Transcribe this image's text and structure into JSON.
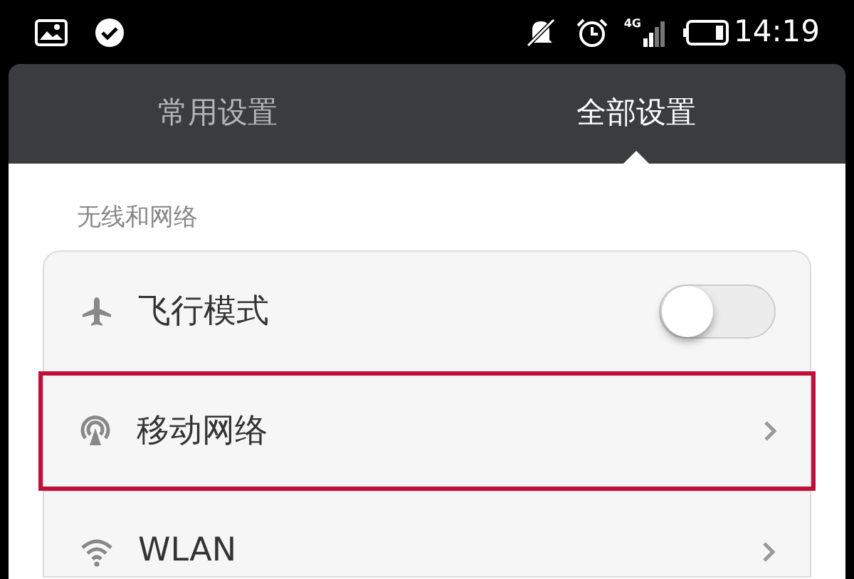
{
  "status_bar": {
    "network": "4G",
    "time": "14:19"
  },
  "tabs": [
    {
      "label": "常用设置",
      "selected": false
    },
    {
      "label": "全部设置",
      "selected": true
    }
  ],
  "section": {
    "title": "无线和网络"
  },
  "rows": [
    {
      "kind": "toggle",
      "label": "飞行模式",
      "on": false,
      "highlighted": false
    },
    {
      "kind": "link",
      "label": "移动网络",
      "highlighted": true
    },
    {
      "kind": "link",
      "label": "WLAN",
      "highlighted": false
    }
  ]
}
